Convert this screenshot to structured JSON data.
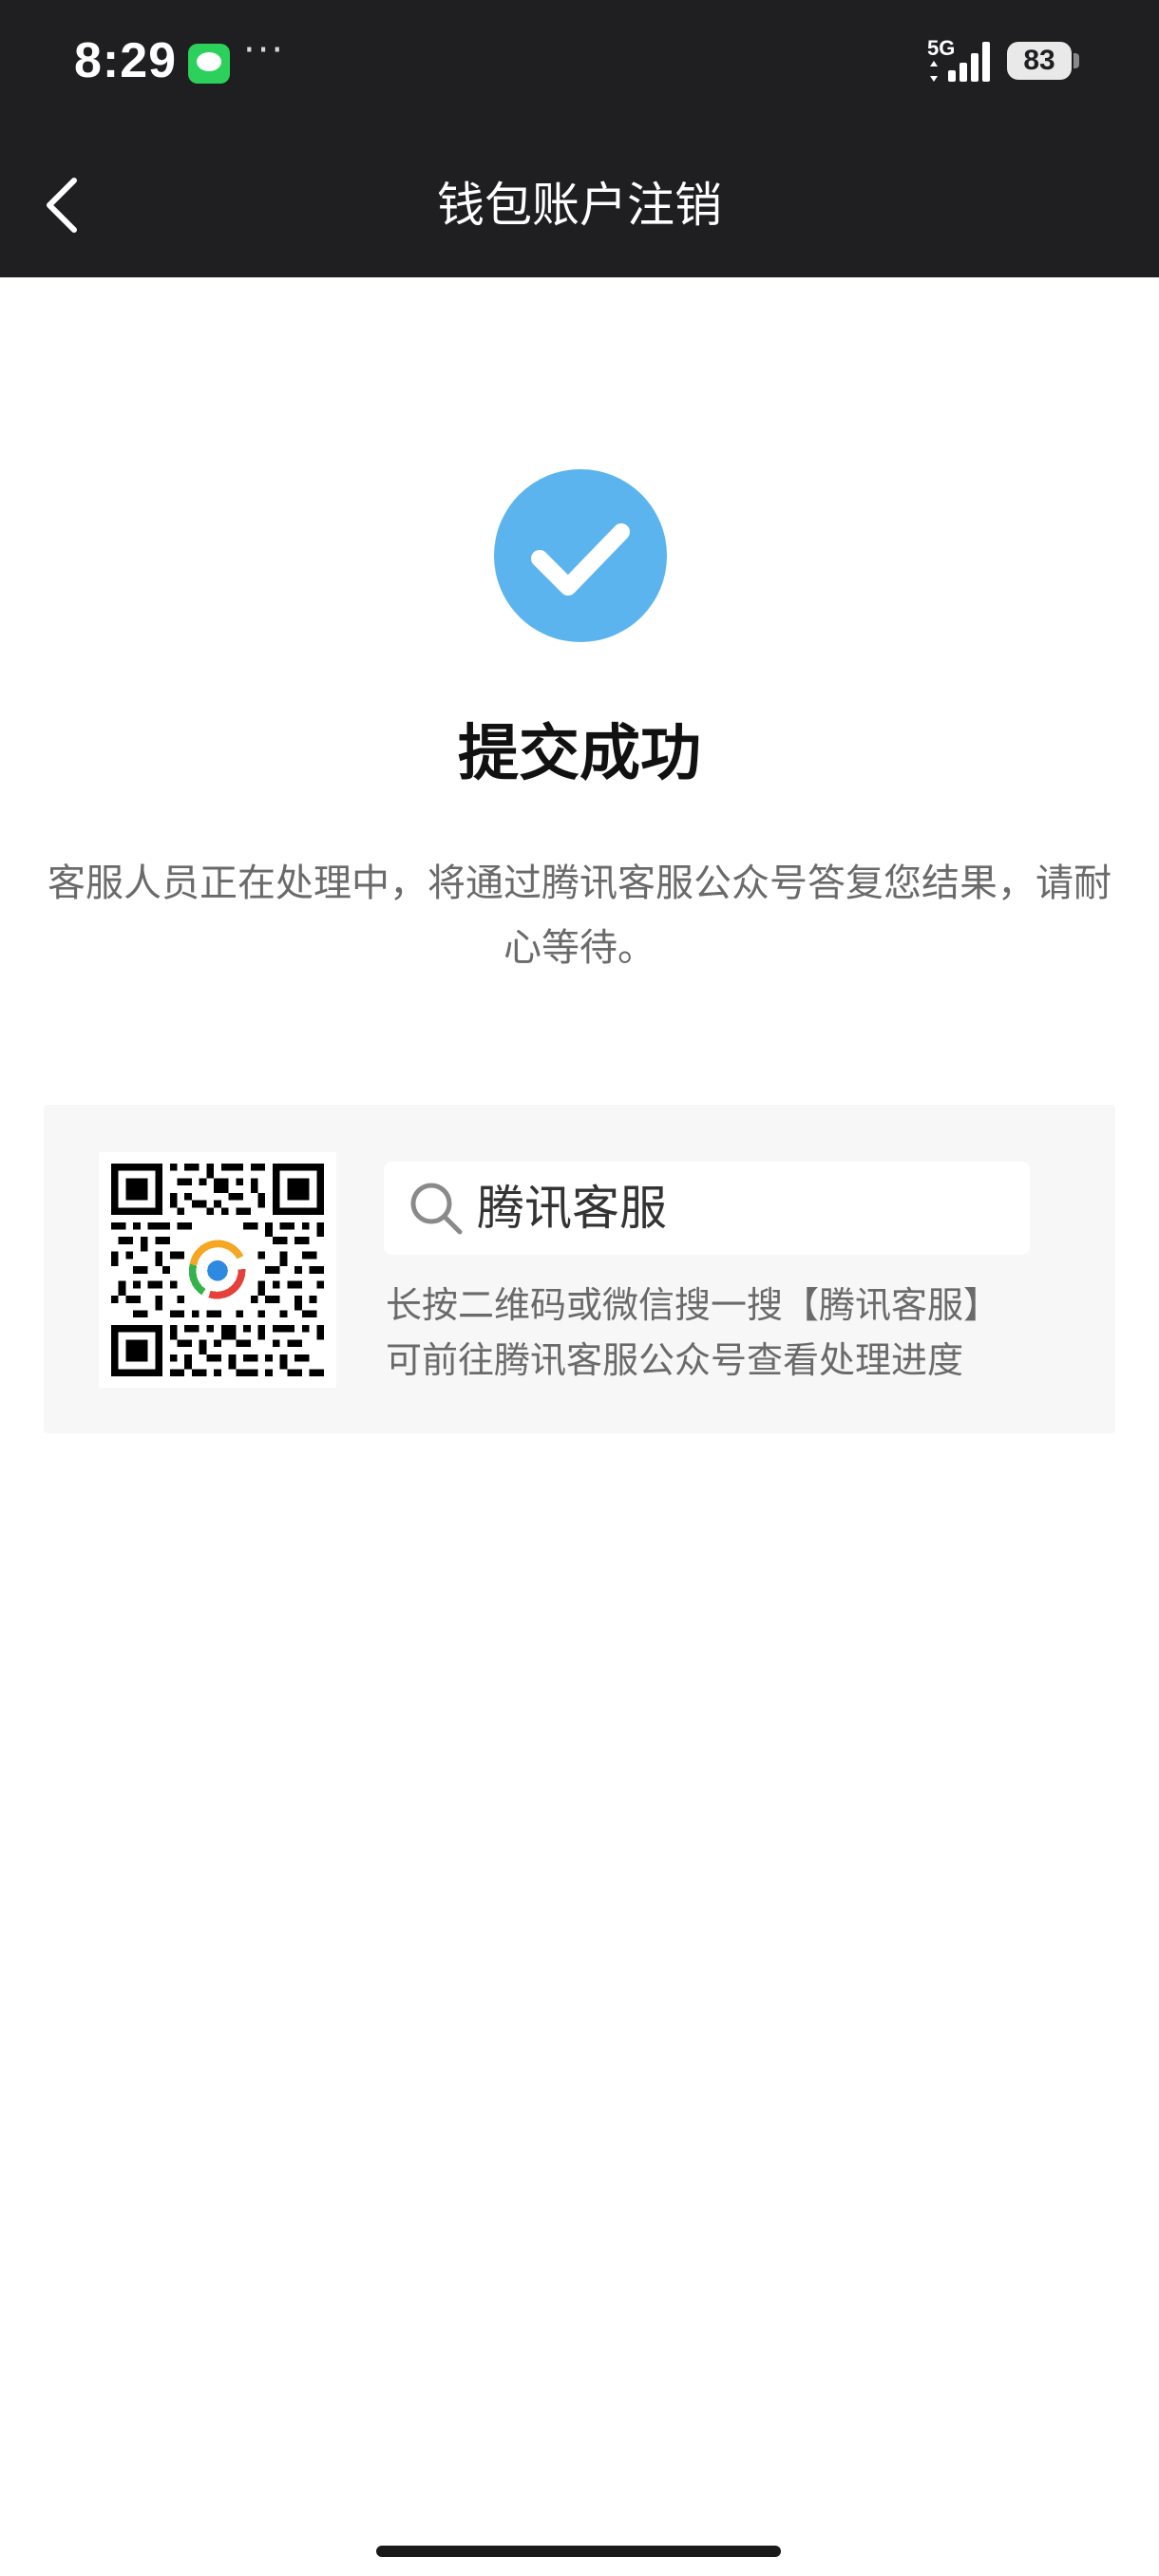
{
  "status_bar": {
    "time": "8:29",
    "more": "···",
    "network": "5G",
    "battery": "83",
    "notification_icon": "message-icon"
  },
  "nav": {
    "title": "钱包账户注销",
    "back_icon": "chevron-left-icon"
  },
  "result": {
    "icon": "check-circle-icon",
    "title": "提交成功",
    "description": "客服人员正在处理中，将通过腾讯客服公众号答复您结果，请耐心等待。"
  },
  "service_card": {
    "qr_icon": "qr-code-icon",
    "search_text": "腾讯客服",
    "hint_line1": "长按二维码或微信搜一搜【腾讯客服】",
    "hint_line2": "可前往腾讯客服公众号查看处理进度"
  },
  "colors": {
    "accent": "#5cb4ee",
    "header": "#1f1f21"
  }
}
